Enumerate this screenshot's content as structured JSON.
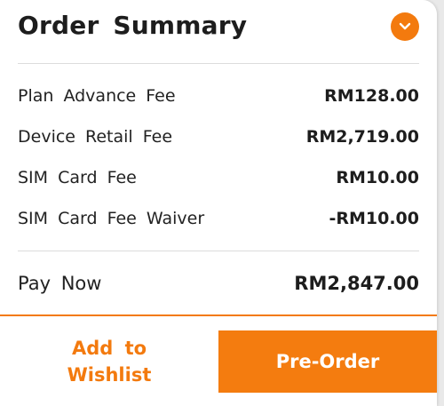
{
  "order_summary": {
    "title": "Order Summary",
    "toggle_icon": "chevron-down-icon",
    "items": [
      {
        "label": "Plan Advance Fee",
        "amount": "RM128.00"
      },
      {
        "label": "Device Retail Fee",
        "amount": "RM2,719.00"
      },
      {
        "label": "SIM Card Fee",
        "amount": "RM10.00"
      },
      {
        "label": "SIM Card Fee Waiver",
        "amount": "-RM10.00"
      }
    ],
    "total": {
      "label": "Pay Now",
      "amount": "RM2,847.00"
    }
  },
  "actions": {
    "wishlist_label": "Add to Wishlist",
    "preorder_label": "Pre-Order"
  },
  "colors": {
    "accent": "#f37a0e",
    "text": "#1d1d1d",
    "divider": "#dcdcdc"
  }
}
